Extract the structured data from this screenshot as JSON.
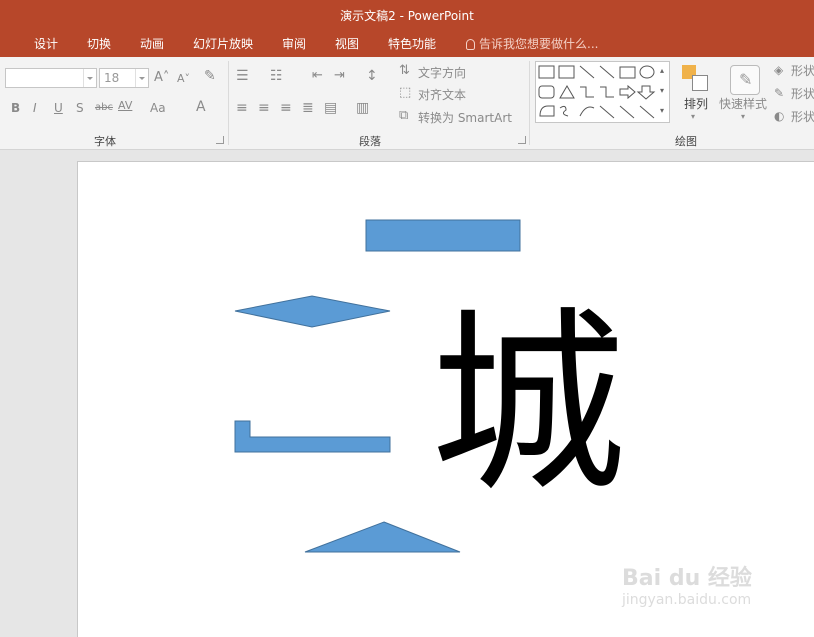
{
  "app": {
    "title": "演示文稿2 - PowerPoint"
  },
  "menu_tabs": [
    {
      "label": "设计"
    },
    {
      "label": "切换"
    },
    {
      "label": "动画"
    },
    {
      "label": "幻灯片放映"
    },
    {
      "label": "审阅"
    },
    {
      "label": "视图"
    },
    {
      "label": "特色功能"
    }
  ],
  "tell_me": {
    "placeholder": "告诉我您想要做什么..."
  },
  "ribbon": {
    "font_group": {
      "label": "字体",
      "font_name_value": "",
      "font_size_value": "18",
      "grow_font": "A˄",
      "shrink_font": "A˅",
      "bold": "B",
      "italic": "I",
      "underline": "U",
      "shadow": "S",
      "strikethrough": "abc",
      "char_spacing": "AV",
      "change_case": "Aa",
      "font_color": "A"
    },
    "paragraph_group": {
      "label": "段落",
      "text_direction": "文字方向",
      "align_text": "对齐文本",
      "convert_smartart": "转换为 SmartArt"
    },
    "drawing_group": {
      "label": "绘图",
      "arrange": "排列",
      "quick_styles": "快速样式",
      "shape_fill": "形状",
      "shape_outline": "形状",
      "shape_effects": "形状"
    }
  },
  "slide": {
    "text_char": "城",
    "shape_color": "#5b9bd5"
  },
  "watermark": {
    "brand": "Bai du 经验",
    "url": "jingyan.baidu.com"
  },
  "colors": {
    "accent": "#b7472a",
    "ribbon_bg": "#f3f3f3",
    "shape_fill": "#5b9bd5"
  }
}
